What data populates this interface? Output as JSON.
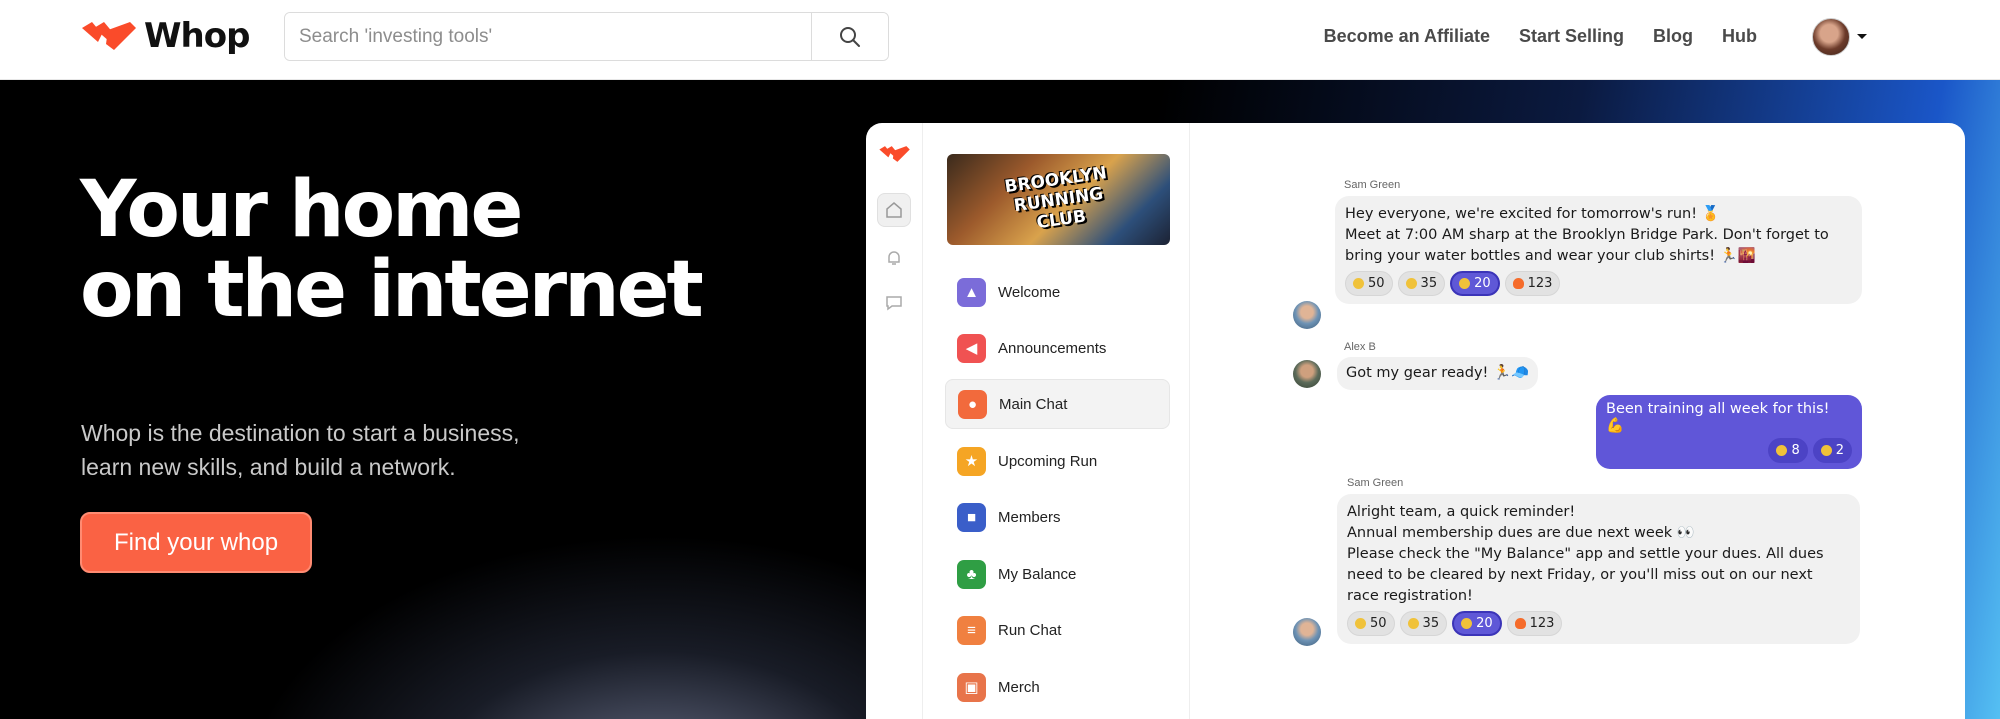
{
  "header": {
    "brand": "Whop",
    "search_placeholder": "Search 'investing tools'",
    "nav": [
      "Become an Affiliate",
      "Start Selling",
      "Blog",
      "Hub"
    ]
  },
  "hero": {
    "title_line1": "Your home",
    "title_line2": "on the internet",
    "subtitle_line1": "Whop is the destination to start a business,",
    "subtitle_line2": "learn new skills, and build a network.",
    "cta": "Find your whop"
  },
  "community": {
    "banner_lines": [
      "BROOKLYN",
      "RUNNING",
      "CLUB"
    ],
    "channels": [
      {
        "label": "Welcome",
        "icon": "welcome-icon",
        "color": "#7b6cd9"
      },
      {
        "label": "Announcements",
        "icon": "megaphone-icon",
        "color": "#f05252"
      },
      {
        "label": "Main Chat",
        "icon": "chat-bubble-icon",
        "color": "#f26a3c"
      },
      {
        "label": "Upcoming Run",
        "icon": "star-icon",
        "color": "#f5a524"
      },
      {
        "label": "Members",
        "icon": "members-icon",
        "color": "#3a5ec9"
      },
      {
        "label": "My Balance",
        "icon": "money-icon",
        "color": "#2f9e44"
      },
      {
        "label": "Run Chat",
        "icon": "run-chat-icon",
        "color": "#f08040"
      },
      {
        "label": "Merch",
        "icon": "merch-icon",
        "color": "#e8744a"
      }
    ],
    "active_channel": "Main Chat"
  },
  "chat": {
    "msg1": {
      "author": "Sam Green",
      "lines": [
        "Hey everyone, we're excited for tomorrow's run! 🏅",
        "Meet at 7:00 AM sharp at the Brooklyn Bridge Park. Don't forget to",
        "bring your water bottles and wear your club shirts! 🏃🌇"
      ],
      "reactions": [
        "50",
        "35",
        "20",
        "123"
      ]
    },
    "msg2": {
      "author": "Alex B",
      "text": "Got my gear ready! 🏃🧢"
    },
    "msg3": {
      "text": "Been training all week for this! 💪",
      "reactions": [
        "8",
        "2"
      ]
    },
    "msg4": {
      "author": "Sam Green",
      "lines": [
        "Alright team, a quick reminder!",
        "Annual membership dues are due next week 👀",
        "Please check the \"My Balance\" app and settle your dues. All dues",
        "need to be cleared by next Friday, or you'll miss out on our next",
        "race registration!"
      ],
      "reactions": [
        "50",
        "35",
        "20",
        "123"
      ]
    }
  },
  "colors": {
    "accent": "#fa6244",
    "own_bubble": "#6056d8"
  }
}
